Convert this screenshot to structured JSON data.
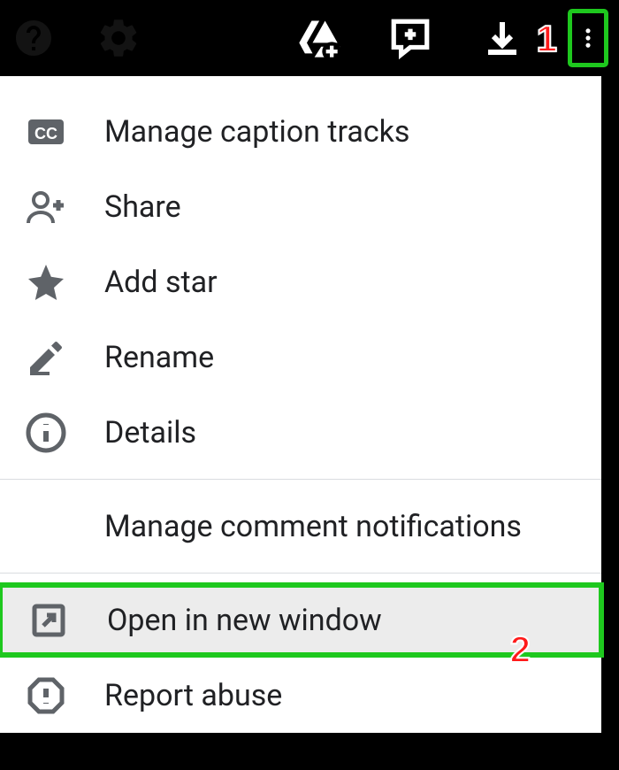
{
  "annotations": {
    "step1": "1",
    "step2": "2"
  },
  "menu": {
    "manage_caption": "Manage caption tracks",
    "share": "Share",
    "add_star": "Add star",
    "rename": "Rename",
    "details": "Details",
    "manage_notifications": "Manage comment notifications",
    "open_new_window": "Open in new window",
    "report_abuse": "Report abuse"
  }
}
